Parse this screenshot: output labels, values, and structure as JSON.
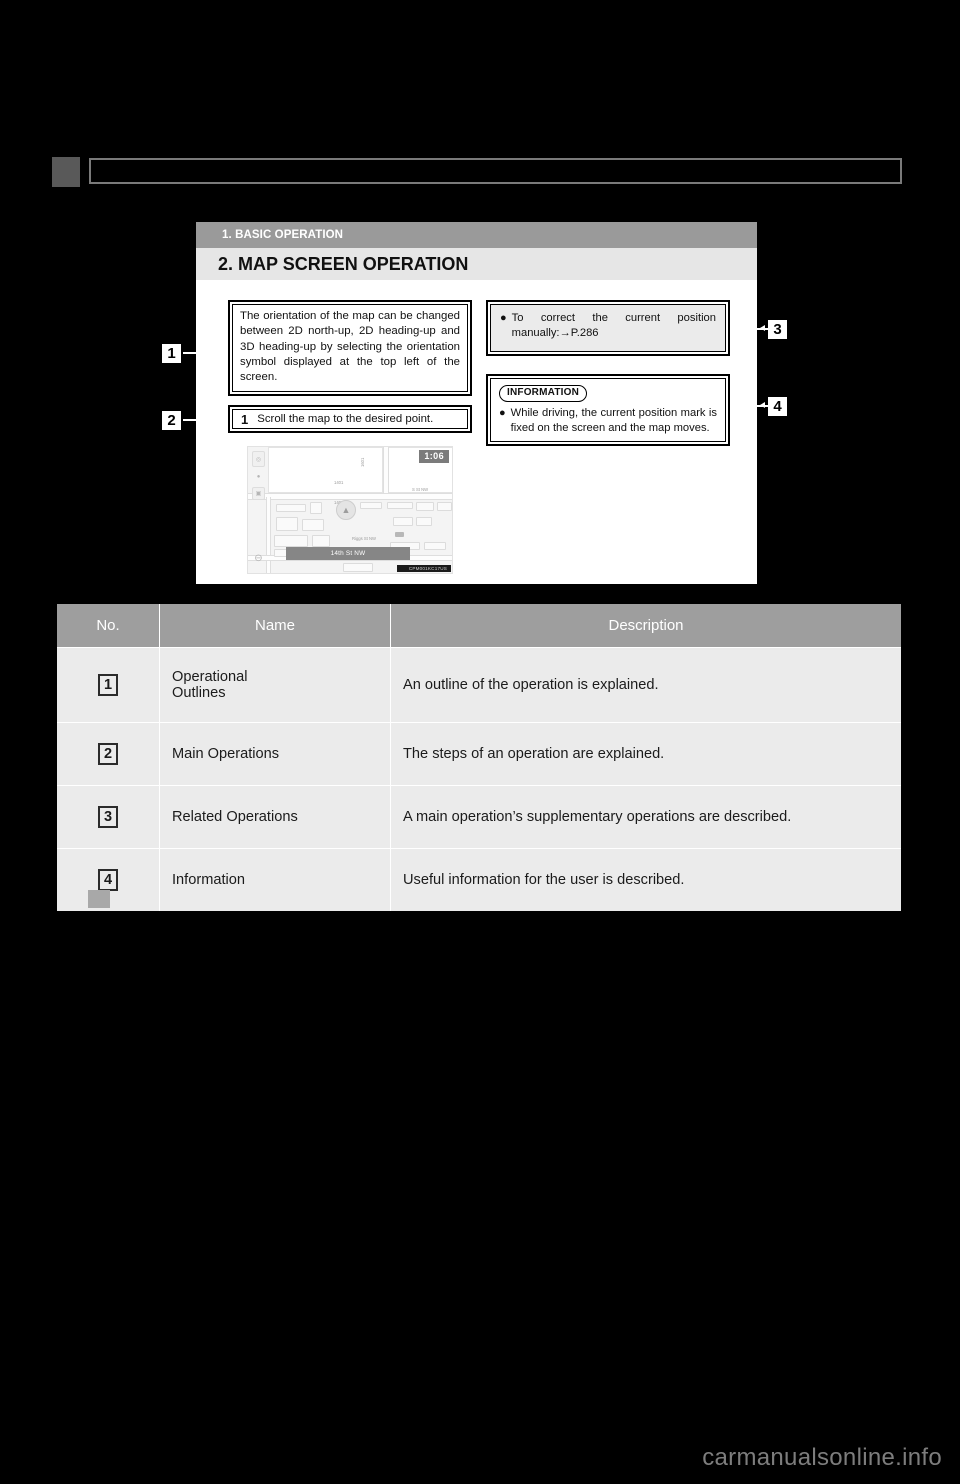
{
  "page": {
    "watermark": "carmanualsonline.info",
    "header_bar": {
      "label": ""
    }
  },
  "figure": {
    "band_section": "1. BASIC OPERATION",
    "band_title": "2. MAP SCREEN OPERATION",
    "operational_outline_text": "The orientation of the map can be changed between 2D north-up, 2D heading-up and 3D heading-up by selecting the orientation symbol displayed at the top left of the screen.",
    "main_operation": {
      "step_number": "1",
      "step_text": "Scroll the map to the desired point."
    },
    "related_operation": {
      "bullet": "●",
      "text": "To correct the current position manually:→P.286"
    },
    "information": {
      "badge": "INFORMATION",
      "bullet": "●",
      "text": "While driving, the current position mark is fixed on the screen and the map moves."
    },
    "callouts": [
      {
        "number": "1"
      },
      {
        "number": "2"
      },
      {
        "number": "3"
      },
      {
        "number": "4"
      }
    ],
    "map_screenshot": {
      "clock": "1:06",
      "street_bar": "14th St NW",
      "labels": [
        "1401",
        "1400",
        "1601",
        "S St NW",
        "Riggs St NW"
      ],
      "watermark": "CPM001KC17US",
      "icons": {
        "orientation": "north-up-orientation-icon",
        "poi": "poi-pin-icon",
        "layer": "map-layer-icon",
        "zoom_out": "zoom-out-icon",
        "current_position": "current-position-mark-icon"
      }
    }
  },
  "legend_table": {
    "headers": [
      "No.",
      "Name",
      "Description"
    ],
    "rows": [
      {
        "no": "1",
        "name": "Operational\nOutlines",
        "name_line1": "Operational",
        "name_line2": "Outlines",
        "description": "An outline of the operation is explained."
      },
      {
        "no": "2",
        "name": "Main Operations",
        "description": "The steps of an operation are explained."
      },
      {
        "no": "3",
        "name": "Related Operations",
        "description": "A main operation’s supplementary operations are described."
      },
      {
        "no": "4",
        "name": "Information",
        "description": "Useful information for the user is described."
      }
    ]
  }
}
